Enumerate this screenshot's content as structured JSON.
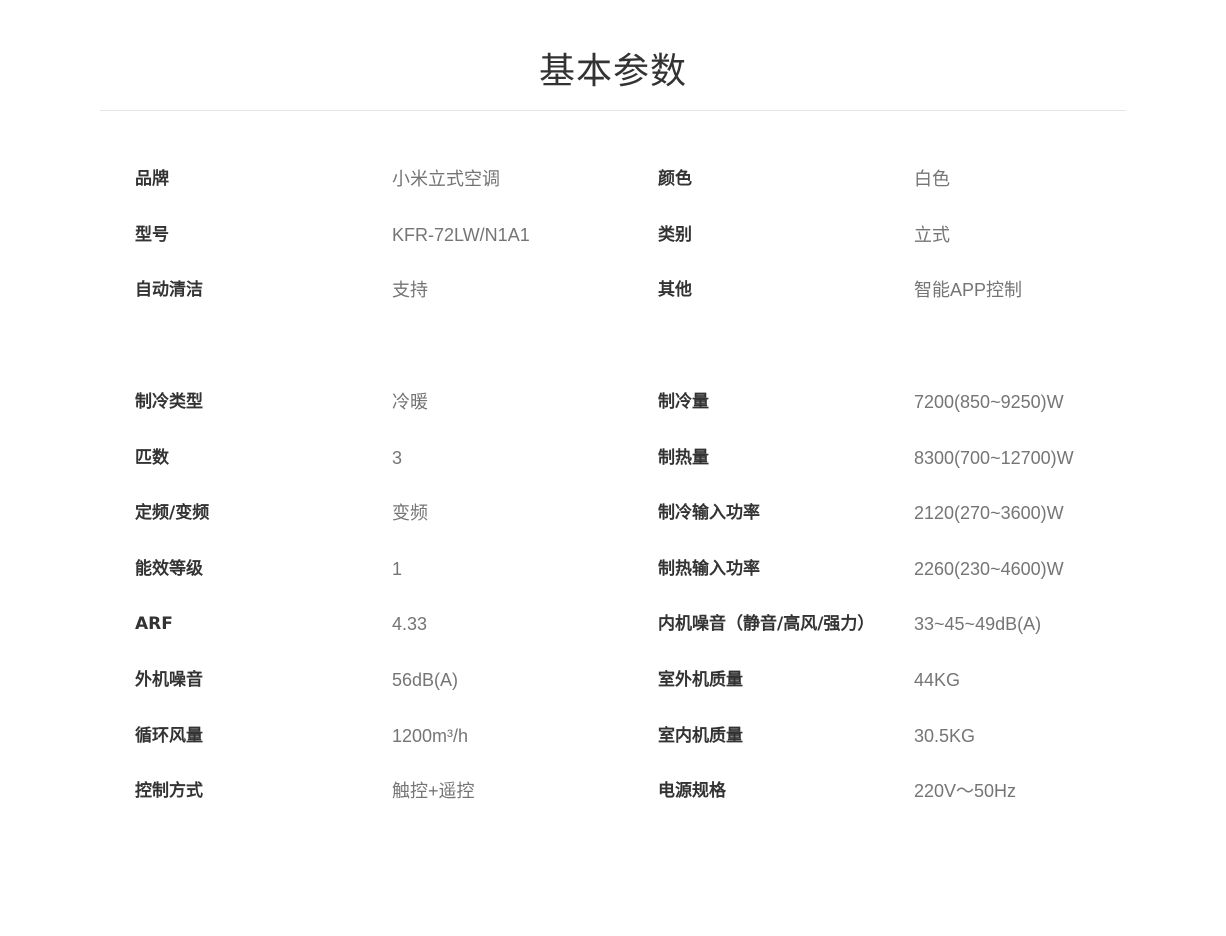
{
  "header": {
    "title": "基本参数"
  },
  "groups": [
    {
      "rows": [
        {
          "label1": "品牌",
          "value1": "小米立式空调",
          "label2": "颜色",
          "value2": "白色"
        },
        {
          "label1": "型号",
          "value1": "KFR-72LW/N1A1",
          "label2": "类别",
          "value2": "立式"
        },
        {
          "label1": "自动清洁",
          "value1": "支持",
          "label2": "其他",
          "value2": "智能APP控制"
        }
      ]
    },
    {
      "rows": [
        {
          "label1": "制冷类型",
          "value1": "冷暖",
          "label2": "制冷量",
          "value2": "7200(850~9250)W"
        },
        {
          "label1": "匹数",
          "value1": "3",
          "label2": "制热量",
          "value2": "8300(700~12700)W"
        },
        {
          "label1": "定频/变频",
          "value1": "变频",
          "label2": "制冷输入功率",
          "value2": "2120(270~3600)W"
        },
        {
          "label1": "能效等级",
          "value1": "1",
          "label2": "制热输入功率",
          "value2": "2260(230~4600)W"
        },
        {
          "label1": "ARF",
          "value1": "4.33",
          "label2": "内机噪音（静音/高风/强力）",
          "value2": "33~45~49dB(A)"
        },
        {
          "label1": "外机噪音",
          "value1": "56dB(A)",
          "label2": "室外机质量",
          "value2": "44KG"
        },
        {
          "label1": "循环风量",
          "value1": "1200m³/h",
          "label2": "室内机质量",
          "value2": "30.5KG"
        },
        {
          "label1": "控制方式",
          "value1": "触控+遥控",
          "label2": "电源规格",
          "value2": "220V～50Hz"
        }
      ]
    }
  ]
}
